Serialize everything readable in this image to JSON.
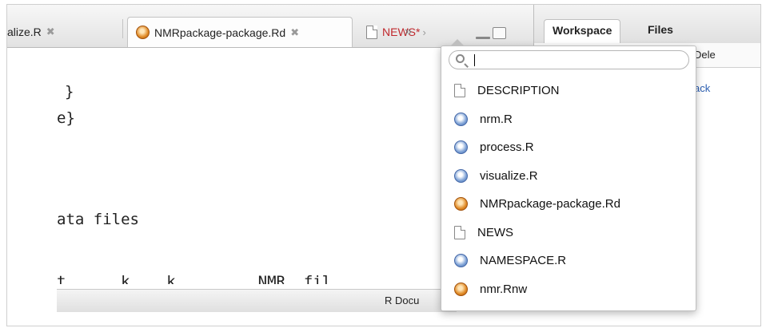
{
  "tabs": [
    {
      "label": "alize.R",
      "type": "r"
    },
    {
      "label": "NMRpackage-package.Rd",
      "type": "rd"
    },
    {
      "label": "NEWS*",
      "type": "doc"
    }
  ],
  "right_pane": {
    "tabs": [
      "Workspace",
      "Files"
    ],
    "toolbar_label": "Dele",
    "link_text": "ack"
  },
  "editor": {
    "lines": [
      "}",
      "e}",
      "ata files",
      "t      k    k         NMR  fil"
    ]
  },
  "status": {
    "label": "R Docu"
  },
  "popup": {
    "search": {
      "value": "",
      "placeholder": ""
    },
    "files": [
      {
        "name": "DESCRIPTION",
        "icon": "doc-icon"
      },
      {
        "name": "nrm.R",
        "icon": "r-file-icon"
      },
      {
        "name": "process.R",
        "icon": "r-file-icon"
      },
      {
        "name": "visualize.R",
        "icon": "r-file-icon"
      },
      {
        "name": "NMRpackage-package.Rd",
        "icon": "rd-file-icon"
      },
      {
        "name": "NEWS",
        "icon": "doc-icon"
      },
      {
        "name": "NAMESPACE.R",
        "icon": "r-file-icon"
      },
      {
        "name": "nmr.Rnw",
        "icon": "rnw-file-icon"
      }
    ]
  },
  "colors": {
    "modified_tab": "#c0282d",
    "link": "#2a5db0"
  }
}
